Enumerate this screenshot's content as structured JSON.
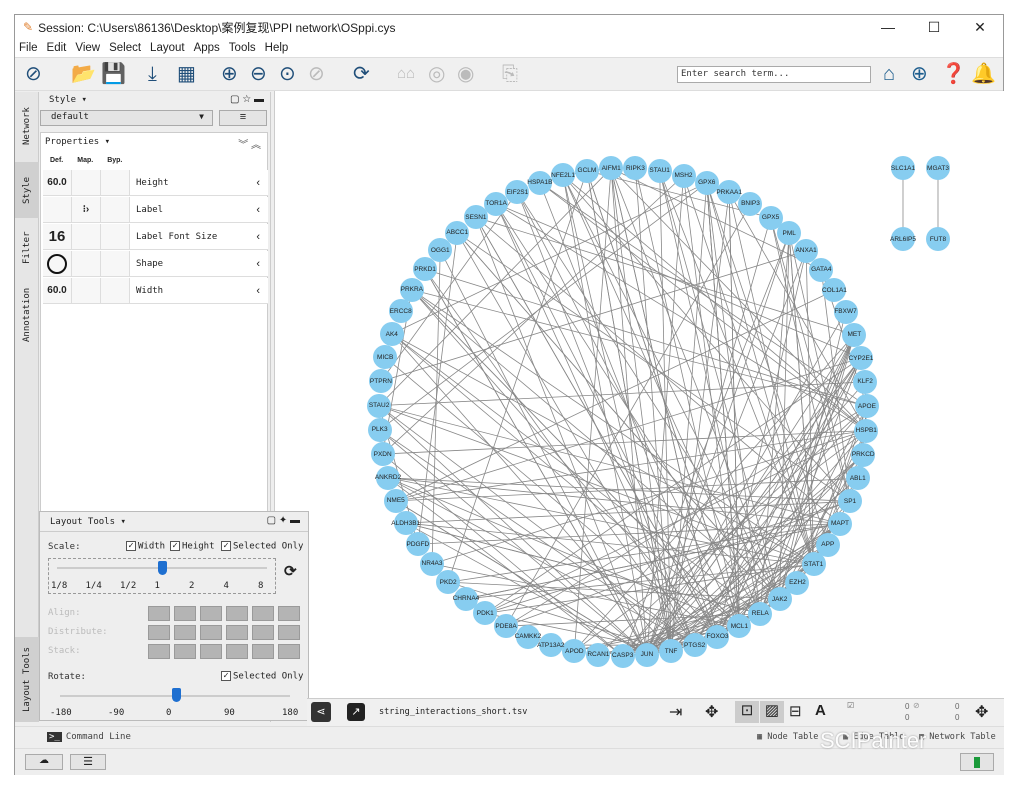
{
  "window": {
    "title": "Session: C:\\Users\\86136\\Desktop\\案例复现\\PPI network\\OSppi.cys",
    "controls": [
      "—",
      "☐",
      "✕"
    ]
  },
  "menu": [
    "File",
    "Edit",
    "View",
    "Select",
    "Layout",
    "Apps",
    "Tools",
    "Help"
  ],
  "search": {
    "placeholder": "Enter search term..."
  },
  "side_tabs": [
    "Network",
    "Style",
    "Filter",
    "Annotation",
    "Layout Tools"
  ],
  "style_panel": {
    "title": "Style ▾",
    "style_name": "default",
    "properties_title": "Properties ▾",
    "columns": [
      "Def.",
      "Map.",
      "Byp."
    ],
    "rows": [
      {
        "def": "60.0",
        "label": "Height"
      },
      {
        "def": "",
        "label": "Label"
      },
      {
        "def": "16",
        "label": "Label Font Size"
      },
      {
        "def": "",
        "label": "Shape"
      },
      {
        "def": "60.0",
        "label": "Width"
      }
    ]
  },
  "layout_tools": {
    "title": "Layout Tools ▾",
    "scale_label": "Scale:",
    "width_label": "Width",
    "height_label": "Height",
    "selected_only": "Selected Only",
    "scale_ticks": [
      "1/8",
      "1/4",
      "1/2",
      "1",
      "2",
      "4",
      "8"
    ],
    "scale_value": 1,
    "align_label": "Align:",
    "distribute_label": "Distribute:",
    "stack_label": "Stack:",
    "rotate_label": "Rotate:",
    "rotate_ticks": [
      "-180",
      "-90",
      "0",
      "90",
      "180"
    ],
    "rotate_value": 0
  },
  "bottom": {
    "network_name": "string_interactions_short.tsv",
    "counts": [
      "0",
      "0",
      "0",
      "0"
    ]
  },
  "tables": {
    "command_line": "Command Line",
    "node_table": "Node Table",
    "edge_table": "Edge Table",
    "network_table": "Network Table"
  },
  "watermark": "SCIPainter",
  "colors": {
    "node": "#87cdf0",
    "edge": "#888888",
    "accent": "#1e6fd0"
  },
  "network": {
    "circle_nodes": [
      "GCLM",
      "AIFM1",
      "RIPK3",
      "STAU1",
      "MSH2",
      "GPX6",
      "PRKAA1",
      "BNIP3",
      "GPX5",
      "PML",
      "ANXA1",
      "GATA4",
      "COL1A1",
      "FBXW7",
      "MET",
      "CYP2E1",
      "KLF2",
      "APOE",
      "HSPB1",
      "PRKCD",
      "ABL1",
      "SP1",
      "MAPT",
      "APP",
      "STAT1",
      "EZH2",
      "JAK2",
      "RELA",
      "MCL1",
      "FOXO3",
      "PTGS2",
      "TNF",
      "JUN",
      "CASP3",
      "RCAN1",
      "APOD",
      "ATP13A2",
      "CAMKK2",
      "PDE8A",
      "PDK1",
      "CHRNA4",
      "PKD2",
      "NR4A3",
      "PDGFD",
      "ALDH3B1",
      "NME5",
      "ANKRD2",
      "PXDN",
      "PLK3",
      "STAU2",
      "PTPRN",
      "MICB",
      "AK4",
      "ERCC8",
      "PRKRA",
      "PRKD1",
      "OGG1",
      "ABCC1",
      "SESN1",
      "TOR1A",
      "EIF2S1",
      "HSPA1B",
      "NFE2L1"
    ],
    "pairs": [
      [
        "SLC1A1",
        "ARL6IP5"
      ],
      [
        "MGAT3",
        "FUT8"
      ]
    ]
  }
}
